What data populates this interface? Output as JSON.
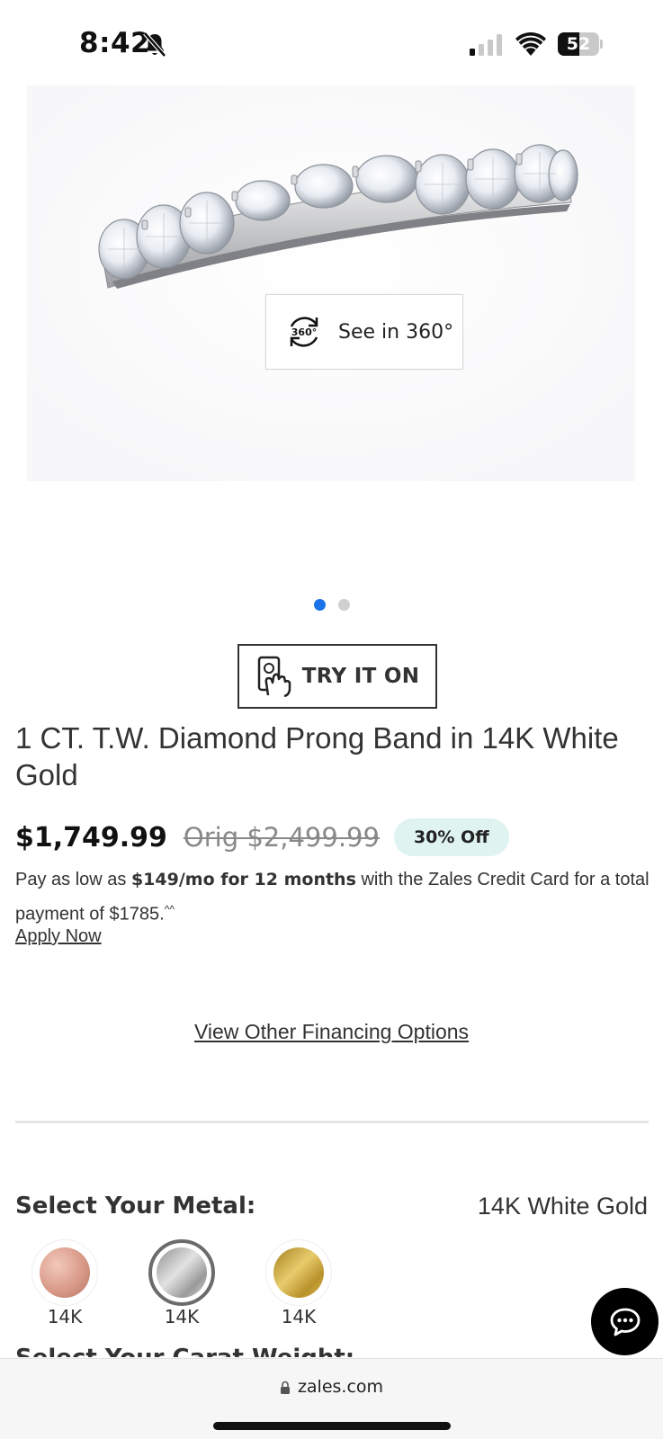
{
  "status_bar": {
    "time": "8:42",
    "battery": "52",
    "battery_level": 0.52
  },
  "gallery": {
    "see_360_label": "See in 360°",
    "icon_360_text": "360°",
    "slide_count": 2,
    "active_slide": 1
  },
  "try_on": {
    "label": "TRY IT ON"
  },
  "product": {
    "title": "1 CT. T.W. Diamond Prong Band in 14K White Gold",
    "price": "$1,749.99",
    "orig_price": "Orig $2,499.99",
    "discount_badge": "30% Off"
  },
  "financing": {
    "prefix": "Pay as low as ",
    "bold_text": "$149/mo for 12 months",
    "suffix": " with the Zales Credit Card for a total payment of $1785.",
    "footnote_mark": "^^",
    "apply_link": "Apply Now",
    "other_options_link": "View Other Financing Options"
  },
  "metal": {
    "heading": "Select Your Metal:",
    "selected_value": "14K White Gold",
    "options": [
      {
        "label": "14K",
        "color": "#d99a88",
        "selected": false
      },
      {
        "label": "14K",
        "color": "#b8b8b8",
        "selected": true
      },
      {
        "label": "14K",
        "color": "#c9a536",
        "selected": false
      }
    ]
  },
  "carat": {
    "heading": "Select Your Carat Weight:"
  },
  "browser": {
    "url": "zales.com"
  },
  "colors": {
    "accent_dot": "#1a73e8",
    "badge_bg": "#dff3f0"
  }
}
